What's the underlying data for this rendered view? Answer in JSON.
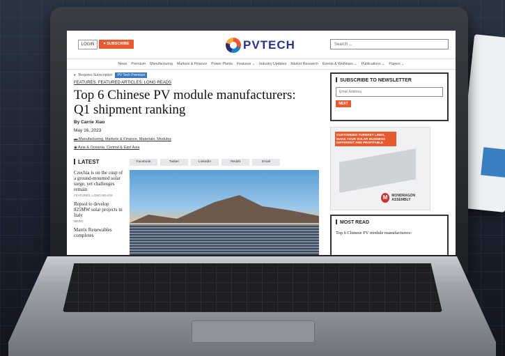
{
  "header": {
    "login": "LOGIN",
    "subscribe": "SUBSCRIBE",
    "logo_text": "PVTECH",
    "search_placeholder": "Search ..."
  },
  "nav": [
    "News",
    "Premium",
    "Manufacturing",
    "Markets & Finance",
    "Power Plants",
    "Features ⌄",
    "Industry Updates",
    "Market Research",
    "Events & Webinars ⌄",
    "Publications ⌄",
    "Papers ⌄"
  ],
  "article": {
    "requires": "Requires Subscription",
    "premium_badge": "PV Tech Premium",
    "categories": "FEATURES, FEATURED ARTICLES, LONG READS",
    "title": "Top 6 Chinese PV module manufacturers: Q1 shipment ranking",
    "author": "By Carrie Xiao",
    "date": "May 16, 2023",
    "tags": "Manufacturing, Markets & Finance, Materials, Modules",
    "regions": "Asia & Oceania, Central & East Asia"
  },
  "latest": {
    "heading": "LATEST",
    "items": [
      {
        "title": "Czechia is on the cusp of a ground-mounted solar surge, yet challenges remain",
        "meta": "FEATURES, LONG READS"
      },
      {
        "title": "Repsol to develop 825MW solar projects in Italy",
        "meta": "NEWS"
      },
      {
        "title": "Matrix Renewables completes",
        "meta": ""
      }
    ]
  },
  "share": [
    "Facebook",
    "Twitter",
    "LinkedIn",
    "Reddit",
    "Email"
  ],
  "sidebar": {
    "newsletter_heading": "SUBSCRIBE TO NEWSLETTER",
    "email_placeholder": "Email Address",
    "next": "NEXT",
    "ad_text": "CUSTOMIZED TURNKEY LINES, MAKE YOUR SOLAR BUSINESS DIFFERENT AND PROFITABLE",
    "ad_brand": "MONDRAGON ASSEMBLY",
    "most_read_heading": "MOST READ",
    "most_read_item": "Top 6 Chinese PV module manufacturers:"
  },
  "colors": {
    "accent": "#e8592d",
    "brand": "#27338a",
    "premium": "#3b78c0"
  }
}
